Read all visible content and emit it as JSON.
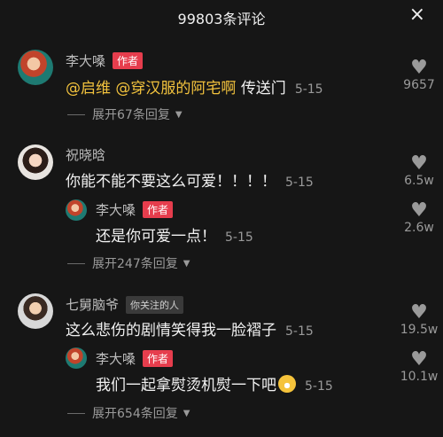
{
  "header": {
    "title": "99803条评论",
    "close_icon": "×"
  },
  "comments": [
    {
      "user": "李大嗓",
      "badge": "作者",
      "mention1": "@启维",
      "mention2": "@穿汉服的阿宅啊",
      "text": "传送门",
      "time": "5-15",
      "likes": "9657",
      "expand": "展开67条回复"
    },
    {
      "user": "祝晓晗",
      "text": "你能不能不要这么可爱！！！！",
      "time": "5-15",
      "likes": "6.5w",
      "reply": {
        "user": "李大嗓",
        "badge": "作者",
        "text": "还是你可爱一点！",
        "time": "5-15",
        "likes": "2.6w"
      },
      "expand": "展开247条回复"
    },
    {
      "user": "七舅脑爷",
      "badge": "你关注的人",
      "text": "这么悲伤的剧情笑得我一脸褶子",
      "time": "5-15",
      "likes": "19.5w",
      "reply": {
        "user": "李大嗓",
        "badge": "作者",
        "text": "我们一起拿熨烫机熨一下吧",
        "time": "5-15",
        "likes": "10.1w"
      },
      "expand": "展开654条回复"
    }
  ],
  "icons": {
    "heart": "heart-icon",
    "chevron": "chevron-down-icon",
    "emoji": "laughing-emoji-icon"
  }
}
